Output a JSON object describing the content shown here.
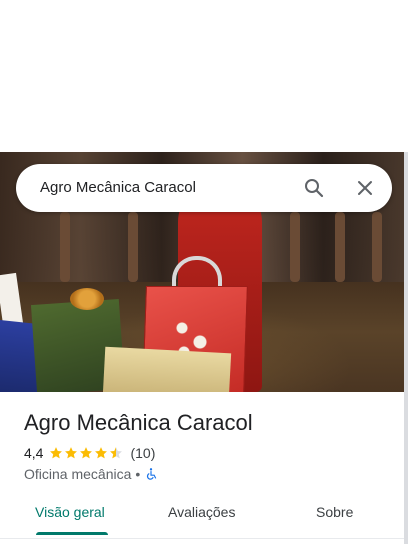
{
  "search": {
    "query": "Agro Mecânica Caracol"
  },
  "place": {
    "name": "Agro Mecânica Caracol",
    "rating": "4,4",
    "rating_value": 4.4,
    "review_count": "(10)",
    "category": "Oficina mecânica",
    "separator": "•",
    "accessibility_icon": "wheelchair-icon"
  },
  "tabs": [
    {
      "label": "Visão geral",
      "active": true
    },
    {
      "label": "Avaliações",
      "active": false
    },
    {
      "label": "Sobre",
      "active": false
    }
  ],
  "colors": {
    "star": "#fbbc04",
    "accent": "#00796b",
    "accessibility": "#1a73e8"
  }
}
